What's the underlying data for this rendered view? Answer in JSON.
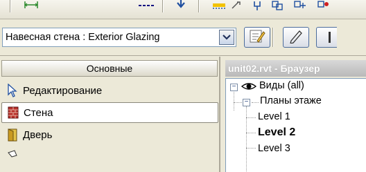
{
  "toolbar": {
    "icons": [
      "dimension-icon",
      "tag-icon",
      "down-arrow-icon",
      "highlight-icon",
      "dim-style-icon",
      "pin-icon",
      "copy-icon",
      "copy-icon-2",
      "delete-icon"
    ]
  },
  "type_selector": {
    "value": "Навесная стена : Exterior Glazing",
    "dropdown_icon": "chevron-down-icon",
    "properties_icon": "properties-icon",
    "edit_icon": "pencil-icon"
  },
  "design_bar": {
    "header": "Основные",
    "items": [
      {
        "label": "Редактирование",
        "icon": "cursor-icon",
        "active": false
      },
      {
        "label": "Стена",
        "icon": "wall-icon",
        "active": true
      },
      {
        "label": "Дверь",
        "icon": "door-icon",
        "active": false
      },
      {
        "label": "",
        "icon": "window-icon",
        "active": false
      }
    ]
  },
  "project_browser": {
    "title": "unit02.rvt - Браузер",
    "tree": [
      {
        "label": "Виды (all)",
        "bold": false,
        "icon": "eye-icon",
        "expander": "−"
      },
      {
        "label": "Планы этаже",
        "bold": false,
        "icon": "",
        "expander": "−"
      },
      {
        "label": "Level 1",
        "bold": false,
        "icon": "",
        "expander": ""
      },
      {
        "label": "Level 2",
        "bold": true,
        "icon": "",
        "expander": ""
      },
      {
        "label": "Level 3",
        "bold": false,
        "icon": "",
        "expander": ""
      }
    ]
  },
  "colors": {
    "chrome": "#ece9d8",
    "combo_border": "#7f9db9",
    "browser_title": "#c4c4c4",
    "accent_blue": "#1f4fa0"
  }
}
